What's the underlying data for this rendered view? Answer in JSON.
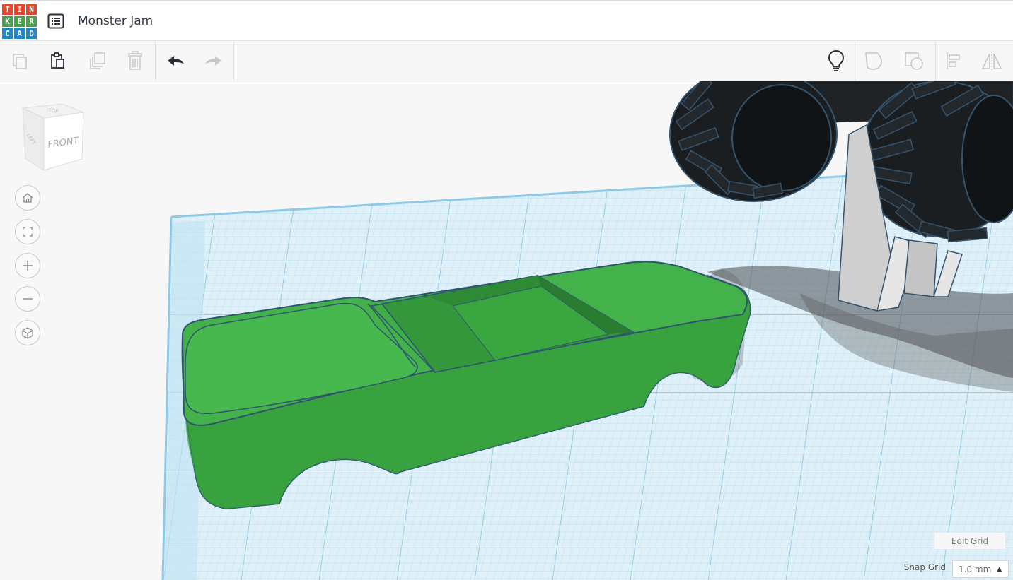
{
  "app": {
    "logo_letters": [
      "T",
      "I",
      "N",
      "K",
      "E",
      "R",
      "C",
      "A",
      "D"
    ],
    "logo_colors": [
      "#e8462c",
      "#e8462c",
      "#e8462c",
      "#4aa04b",
      "#4aa04b",
      "#4aa04b",
      "#1e88c9",
      "#1e88c9",
      "#1e88c9"
    ],
    "project_title": "Monster Jam"
  },
  "toolbar": {
    "left_buttons": [
      {
        "name": "copy-button",
        "icon": "copy-icon",
        "enabled": false
      },
      {
        "name": "paste-button",
        "icon": "paste-icon",
        "enabled": true
      },
      {
        "name": "duplicate-button",
        "icon": "duplicate-icon",
        "enabled": false
      },
      {
        "name": "delete-button",
        "icon": "trash-icon",
        "enabled": false
      },
      {
        "name": "undo-button",
        "icon": "undo-icon",
        "enabled": true
      },
      {
        "name": "redo-button",
        "icon": "redo-icon",
        "enabled": false
      }
    ],
    "right_buttons": [
      {
        "name": "notes-button",
        "icon": "lightbulb-icon",
        "enabled": true
      },
      {
        "name": "group-button",
        "icon": "group-icon",
        "enabled": false
      },
      {
        "name": "ungroup-button",
        "icon": "ungroup-icon",
        "enabled": false
      },
      {
        "name": "align-button",
        "icon": "align-icon",
        "enabled": false
      },
      {
        "name": "mirror-button",
        "icon": "mirror-icon",
        "enabled": false
      }
    ]
  },
  "view_cube": {
    "top_label": "TOP",
    "front_label": "FRONT",
    "left_label": "LEFT"
  },
  "navigation": [
    {
      "name": "home-view-button",
      "icon": "home-icon"
    },
    {
      "name": "fit-view-button",
      "icon": "fit-all-icon"
    },
    {
      "name": "zoom-in-button",
      "icon": "plus-icon"
    },
    {
      "name": "zoom-out-button",
      "icon": "minus-icon"
    },
    {
      "name": "perspective-button",
      "icon": "cube-icon"
    }
  ],
  "grid": {
    "edit_grid_label": "Edit Grid",
    "snap_grid_label": "Snap Grid",
    "snap_grid_value": "1.0 mm",
    "snap_grid_arrow": "▲"
  },
  "colors": {
    "car_body": "#3fae45",
    "car_dark": "#2f8c35",
    "workplane": "#d8edf7",
    "grid_line": "#9fd0e8",
    "tire": "#1f2326"
  }
}
